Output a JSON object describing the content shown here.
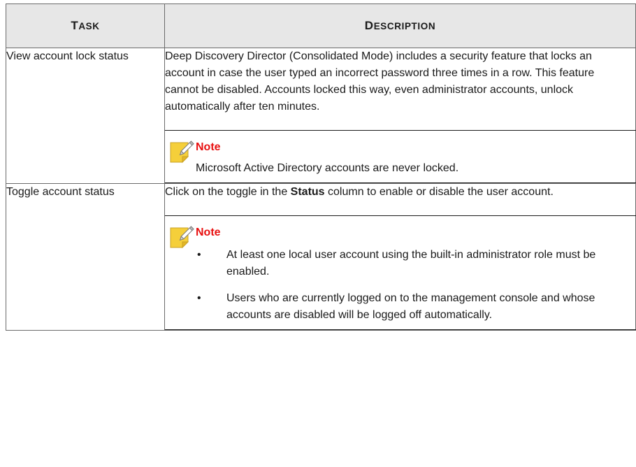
{
  "table": {
    "headers": {
      "task": {
        "first": "T",
        "rest": "ASK"
      },
      "description": {
        "first": "D",
        "rest": "ESCRIPTION"
      }
    },
    "rows": [
      {
        "task": "View account lock status",
        "description": "Deep Discovery Director (Consolidated Mode) includes a security feature that locks an account in case the user typed an incorrect password three times in a row. This feature cannot be disabled. Accounts locked this way, even administrator accounts, unlock automatically after ten minutes.",
        "note": {
          "title": "Note",
          "text": "Microsoft Active Directory accounts are never locked."
        }
      },
      {
        "task": "Toggle account status",
        "description_before": "Click on the toggle in the ",
        "description_bold": "Status",
        "description_after": " column to enable or disable the user account.",
        "note": {
          "title": "Note",
          "bullets": [
            "At least one local user account using the built-in administrator role must be enabled.",
            "Users who are currently logged on to the management console and whose accounts are disabled will be logged off automatically."
          ]
        }
      }
    ]
  },
  "icons": {
    "note": "note-pencil-icon",
    "note_color": "#f5cf3a",
    "note_title_color": "#e81010"
  }
}
